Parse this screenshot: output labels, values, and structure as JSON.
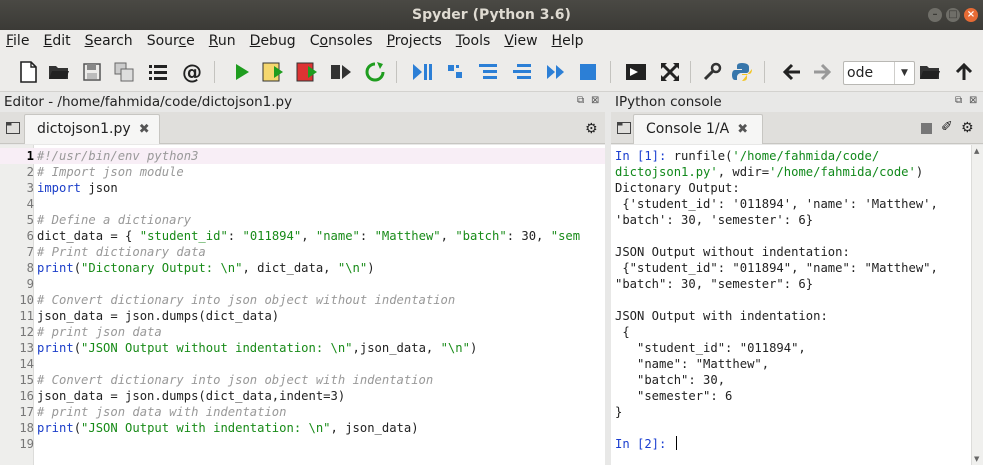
{
  "window": {
    "title": "Spyder (Python 3.6)"
  },
  "menu": {
    "items": [
      {
        "u": "F",
        "rest": "ile"
      },
      {
        "u": "E",
        "rest": "dit"
      },
      {
        "u": "S",
        "rest": "earch"
      },
      {
        "pre": "Sour",
        "u": "c",
        "rest": "e"
      },
      {
        "u": "R",
        "rest": "un"
      },
      {
        "u": "D",
        "rest": "ebug"
      },
      {
        "pre": "C",
        "u": "o",
        "rest": "nsoles"
      },
      {
        "u": "P",
        "rest": "rojects"
      },
      {
        "u": "T",
        "rest": "ools"
      },
      {
        "u": "V",
        "rest": "iew"
      },
      {
        "u": "H",
        "rest": "elp"
      }
    ]
  },
  "toolbar": {
    "icons": [
      "new-file-icon",
      "open-file-icon",
      "save-icon",
      "save-all-icon",
      "list-icon",
      "at-icon",
      "run-icon",
      "run-cell-icon",
      "run-cell-advance-icon",
      "run-selection-icon",
      "rerun-icon",
      "debug-icon",
      "step-icon",
      "step-into-icon",
      "step-return-icon",
      "continue-icon",
      "stop-icon",
      "maximize-pane-icon",
      "fullscreen-icon",
      "preferences-icon",
      "python-path-icon",
      "back-icon",
      "forward-icon",
      "browse-folder-icon",
      "parent-dir-icon"
    ],
    "working_dir": "ode"
  },
  "editor": {
    "header": "Editor - /home/fahmida/code/dictojson1.py",
    "tab_label": "dictojson1.py",
    "current_line": 1,
    "lines": [
      [
        {
          "c": "cm",
          "t": "#!/usr/bin/env python3"
        }
      ],
      [
        {
          "c": "cm",
          "t": "# Import json module"
        }
      ],
      [
        {
          "c": "kw",
          "t": "import"
        },
        {
          "c": "nm",
          "t": " json"
        }
      ],
      [],
      [
        {
          "c": "cm",
          "t": "# Define a dictionary"
        }
      ],
      [
        {
          "c": "nm",
          "t": "dict_data = { "
        },
        {
          "c": "st",
          "t": "\"student_id\""
        },
        {
          "c": "nm",
          "t": ": "
        },
        {
          "c": "st",
          "t": "\"011894\""
        },
        {
          "c": "nm",
          "t": ", "
        },
        {
          "c": "st",
          "t": "\"name\""
        },
        {
          "c": "nm",
          "t": ": "
        },
        {
          "c": "st",
          "t": "\"Matthew\""
        },
        {
          "c": "nm",
          "t": ", "
        },
        {
          "c": "st",
          "t": "\"batch\""
        },
        {
          "c": "nm",
          "t": ": 30, "
        },
        {
          "c": "st",
          "t": "\"sem"
        }
      ],
      [
        {
          "c": "cm",
          "t": "# Print dictionary data"
        }
      ],
      [
        {
          "c": "kw",
          "t": "print"
        },
        {
          "c": "nm",
          "t": "("
        },
        {
          "c": "st",
          "t": "\"Dictonary Output: \\n\""
        },
        {
          "c": "nm",
          "t": ", dict_data, "
        },
        {
          "c": "st",
          "t": "\"\\n\""
        },
        {
          "c": "nm",
          "t": ")"
        }
      ],
      [],
      [
        {
          "c": "cm",
          "t": "# Convert dictionary into json object without indentation"
        }
      ],
      [
        {
          "c": "nm",
          "t": "json_data = json.dumps(dict_data)"
        }
      ],
      [
        {
          "c": "cm",
          "t": "# print json data"
        }
      ],
      [
        {
          "c": "kw",
          "t": "print"
        },
        {
          "c": "nm",
          "t": "("
        },
        {
          "c": "st",
          "t": "\"JSON Output without indentation: \\n\""
        },
        {
          "c": "nm",
          "t": ",json_data, "
        },
        {
          "c": "st",
          "t": "\"\\n\""
        },
        {
          "c": "nm",
          "t": ")"
        }
      ],
      [],
      [
        {
          "c": "cm",
          "t": "# Convert dictionary into json object with indentation"
        }
      ],
      [
        {
          "c": "nm",
          "t": "json_data = json.dumps(dict_data,indent=3)"
        }
      ],
      [
        {
          "c": "cm",
          "t": "# print json data with indentation"
        }
      ],
      [
        {
          "c": "kw",
          "t": "print"
        },
        {
          "c": "nm",
          "t": "("
        },
        {
          "c": "st",
          "t": "\"JSON Output with indentation: \\n\""
        },
        {
          "c": "nm",
          "t": ", json_data)"
        }
      ],
      []
    ]
  },
  "console": {
    "header": "IPython console",
    "tab_label": "Console 1/A",
    "lines": [
      [
        {
          "c": "pin",
          "t": "In [1]:"
        },
        {
          "c": "nm",
          "t": " runfile("
        },
        {
          "c": "pstr",
          "t": "'/home/fahmida/code/"
        }
      ],
      [
        {
          "c": "pstr",
          "t": "dictojson1.py'"
        },
        {
          "c": "nm",
          "t": ", wdir="
        },
        {
          "c": "pstr",
          "t": "'/home/fahmida/code'"
        },
        {
          "c": "nm",
          "t": ")"
        }
      ],
      [
        {
          "c": "nm",
          "t": "Dictonary Output:"
        }
      ],
      [
        {
          "c": "nm",
          "t": " {'student_id': '011894', 'name': 'Matthew',"
        }
      ],
      [
        {
          "c": "nm",
          "t": "'batch': 30, 'semester': 6}"
        }
      ],
      [],
      [
        {
          "c": "nm",
          "t": "JSON Output without indentation:"
        }
      ],
      [
        {
          "c": "nm",
          "t": " {\"student_id\": \"011894\", \"name\": \"Matthew\","
        }
      ],
      [
        {
          "c": "nm",
          "t": "\"batch\": 30, \"semester\": 6}"
        }
      ],
      [],
      [
        {
          "c": "nm",
          "t": "JSON Output with indentation:"
        }
      ],
      [
        {
          "c": "nm",
          "t": " {"
        }
      ],
      [
        {
          "c": "nm",
          "t": "   \"student_id\": \"011894\","
        }
      ],
      [
        {
          "c": "nm",
          "t": "   \"name\": \"Matthew\","
        }
      ],
      [
        {
          "c": "nm",
          "t": "   \"batch\": 30,"
        }
      ],
      [
        {
          "c": "nm",
          "t": "   \"semester\": 6"
        }
      ],
      [
        {
          "c": "nm",
          "t": "}"
        }
      ],
      [],
      [
        {
          "c": "pin",
          "t": "In [2]:"
        },
        {
          "c": "nm",
          "t": " "
        }
      ]
    ]
  }
}
